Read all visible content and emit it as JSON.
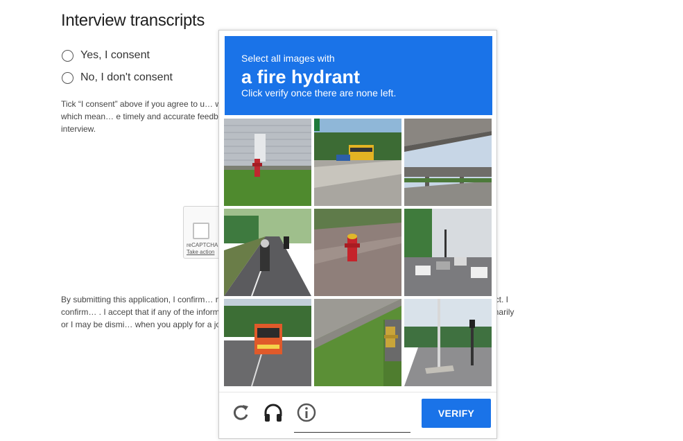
{
  "page": {
    "title": "Interview transcripts",
    "consent_yes": "Yes, I consent",
    "consent_no": "No, I don't consent",
    "consent_paragraph": "Tick “I consent” above if you agree to u… ws (video or audio will not be recorded). T… l in their interview scorecards, which mean… e timely and accurate feedback. Consent… You can withdraw your consent at any time… during any interview.",
    "submit_paragraph": "By submitting this application, I confirm… nt and any additional documents attached… ully suppressed any material fact. I confirm… . I accept that if any of the information giv… application may be rejected, any offer c… y be terminated summarily or I may be dismi… when you apply for a job with us, pleas…"
  },
  "recaptcha": {
    "label": "reCAPTCHA",
    "link": "Take action"
  },
  "challenge": {
    "instruction_small": "Select all images with",
    "target": "a fire hydrant",
    "instruction_sub": "Click verify once there are none left.",
    "verify_label": "VERIFY",
    "header_color": "#1a73e8",
    "tiles": [
      {
        "name": "tile-1",
        "scene": "fire hydrant by gray building on grass"
      },
      {
        "name": "tile-2",
        "scene": "school bus on road"
      },
      {
        "name": "tile-3",
        "scene": "highway overpass"
      },
      {
        "name": "tile-4",
        "scene": "motorcycles on street"
      },
      {
        "name": "tile-5",
        "scene": "red fire hydrant on sidewalk"
      },
      {
        "name": "tile-6",
        "scene": "traffic on street"
      },
      {
        "name": "tile-7",
        "scene": "orange bus on road"
      },
      {
        "name": "tile-8",
        "scene": "yellow fire hydrant on grass"
      },
      {
        "name": "tile-9",
        "scene": "road intersection with poles"
      }
    ],
    "footer_icons": [
      "reload-icon",
      "headphones-icon",
      "info-icon"
    ]
  }
}
